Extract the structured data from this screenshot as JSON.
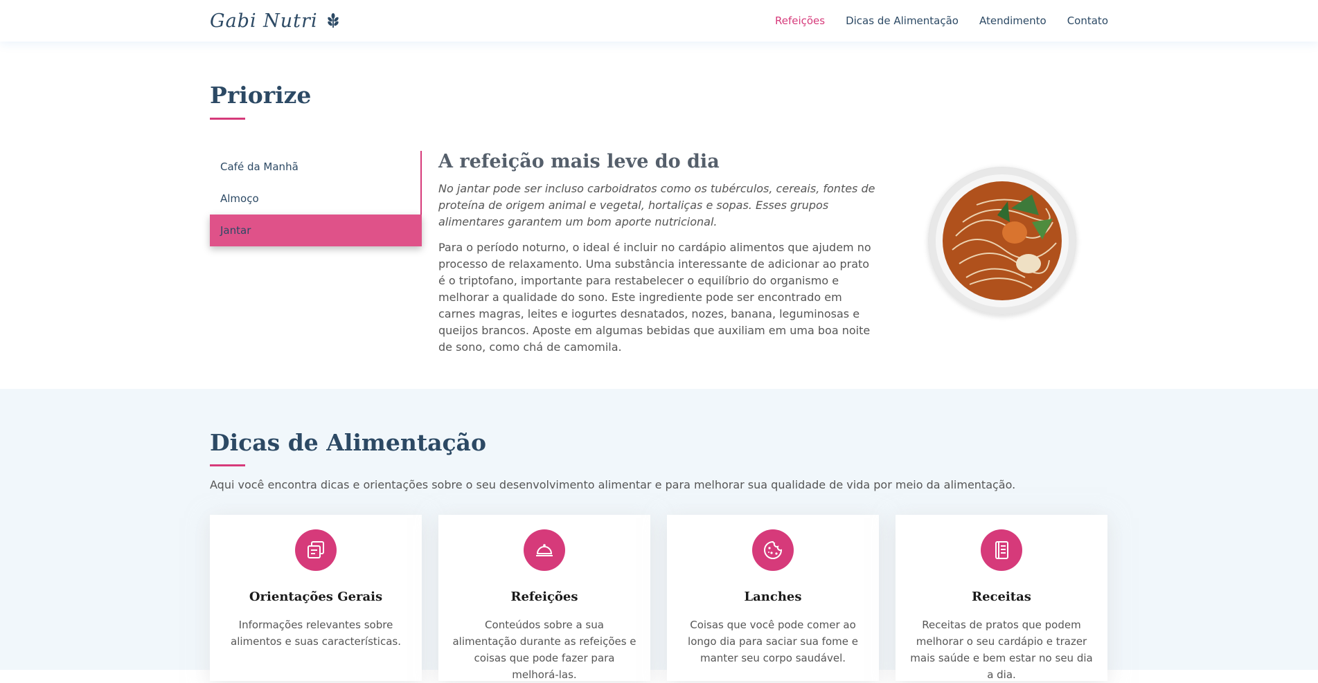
{
  "header": {
    "logo_text": "Gabi Nutri",
    "nav": [
      {
        "label": "Refeições",
        "active": true
      },
      {
        "label": "Dicas de Alimentação",
        "active": false
      },
      {
        "label": "Atendimento",
        "active": false
      },
      {
        "label": "Contato",
        "active": false
      }
    ]
  },
  "priorize": {
    "title": "Priorize",
    "tabs": [
      {
        "label": "Café da Manhã",
        "active": false
      },
      {
        "label": "Almoço",
        "active": false
      },
      {
        "label": "Jantar",
        "active": true
      }
    ],
    "content": {
      "heading": "A refeição mais leve do dia",
      "lead": "No jantar pode ser incluso carboidratos como os tubérculos, cereais, fontes de proteína de origem animal e vegetal, hortaliças e sopas. Esses grupos alimentares garantem um bom aporte nutricional.",
      "body": "Para o período noturno, o ideal é incluir no cardápio alimentos que ajudem no processo de relaxamento. Uma substância interessante de adicionar ao prato é o triptofano, importante para restabelecer o equilíbrio do organismo e melhorar a qualidade do sono. Este ingrediente pode ser encontrado em carnes magras, leites e iogurtes desnatados, nozes, banana, leguminosas e queijos brancos. Aposte em algumas bebidas que auxiliam em uma boa noite de sono, como chá de camomila."
    }
  },
  "dicas": {
    "title": "Dicas de Alimentação",
    "description": "Aqui você encontra dicas e orientações sobre o seu desenvolvimento alimentar e para melhorar sua qualidade de vida por meio da alimentação.",
    "cards": [
      {
        "icon": "documents-icon",
        "title": "Orientações Gerais",
        "text": "Informações relevantes sobre alimentos e suas características."
      },
      {
        "icon": "cloche-icon",
        "title": "Refeições",
        "text": "Conteúdos sobre a sua alimentação durante as refeições e coisas que pode fazer para melhorá-las."
      },
      {
        "icon": "cookie-icon",
        "title": "Lanches",
        "text": "Coisas que você pode comer ao longo dia para saciar sua fome e manter seu corpo saudável."
      },
      {
        "icon": "journal-icon",
        "title": "Receitas",
        "text": "Receitas de pratos que podem melhorar o seu cardápio e trazer mais saúde e bem estar no seu dia a dia."
      }
    ]
  },
  "colors": {
    "accent": "#d63a7a",
    "heading": "#2c4964",
    "tab_active": "#df5289",
    "section_bg": "#f1f7fb"
  }
}
